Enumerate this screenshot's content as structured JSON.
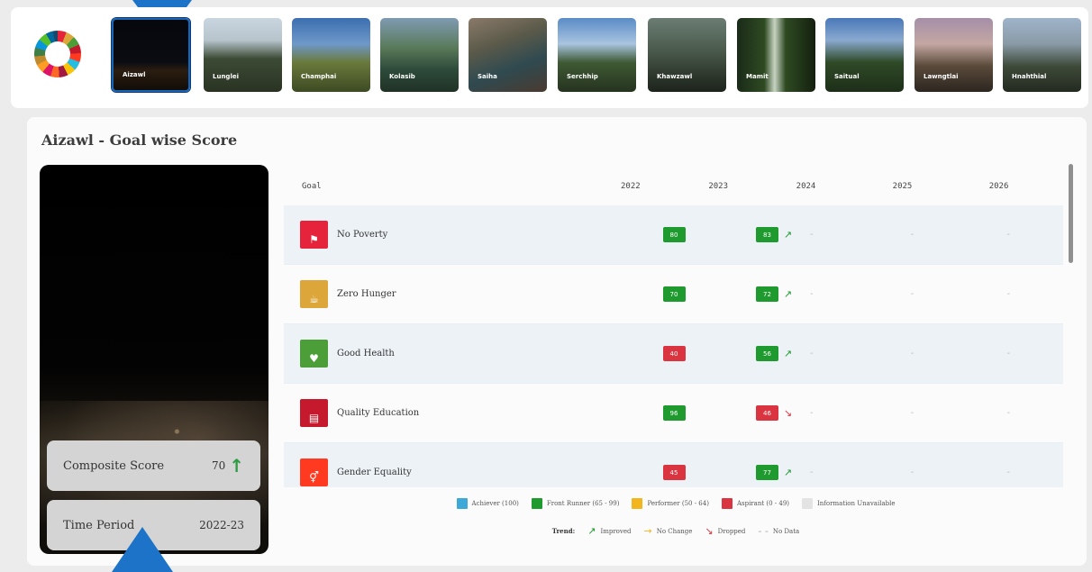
{
  "districts": [
    {
      "name": "Aizawl",
      "active": true
    },
    {
      "name": "Lunglei",
      "active": false
    },
    {
      "name": "Champhai",
      "active": false
    },
    {
      "name": "Kolasib",
      "active": false
    },
    {
      "name": "Saiha",
      "active": false
    },
    {
      "name": "Serchhip",
      "active": false
    },
    {
      "name": "Khawzawl",
      "active": false
    },
    {
      "name": "Mamit",
      "active": false
    },
    {
      "name": "Saitual",
      "active": false
    },
    {
      "name": "Lawngtlai",
      "active": false
    },
    {
      "name": "Hnahthial",
      "active": false
    }
  ],
  "section_title": "Aizawl - Goal wise Score",
  "city_panel": {
    "composite_label": "Composite Score",
    "composite_value": "70",
    "composite_trend": "up",
    "period_label": "Time Period",
    "period_value": "2022-23"
  },
  "table": {
    "headers": {
      "goal": "Goal",
      "y1": "2022",
      "y2": "2023",
      "y3": "2024",
      "y4": "2025",
      "y5": "2026"
    },
    "rows": [
      {
        "name": "No Poverty",
        "icon_color": "#e5243b",
        "icon": "⚑",
        "v1": "80",
        "c1": "green",
        "v2": "83",
        "c2": "green",
        "trend": "up"
      },
      {
        "name": "Zero Hunger",
        "icon_color": "#dda63a",
        "icon": "☕",
        "v1": "70",
        "c1": "green",
        "v2": "72",
        "c2": "green",
        "trend": "up"
      },
      {
        "name": "Good Health",
        "icon_color": "#4c9f38",
        "icon": "♥",
        "v1": "40",
        "c1": "red",
        "v2": "56",
        "c2": "green",
        "trend": "up"
      },
      {
        "name": "Quality Education",
        "icon_color": "#c5192d",
        "icon": "▤",
        "v1": "96",
        "c1": "green",
        "v2": "46",
        "c2": "red",
        "trend": "down"
      },
      {
        "name": "Gender Equality",
        "icon_color": "#ff3a21",
        "icon": "⚥",
        "v1": "45",
        "c1": "red",
        "v2": "77",
        "c2": "green",
        "trend": "up"
      }
    ],
    "dash": "-"
  },
  "legend": {
    "categories": [
      {
        "label": "Achiever (100)",
        "color": "#3ea8d8"
      },
      {
        "label": "Front Runner (65 - 99)",
        "color": "#1f9a2e"
      },
      {
        "label": "Performer (50 - 64)",
        "color": "#f2b51d"
      },
      {
        "label": "Aspirant (0 - 49)",
        "color": "#d9343f"
      },
      {
        "label": "Information Unavailable",
        "color": "#e3e3e3"
      }
    ],
    "trend_label": "Trend:",
    "trends": [
      {
        "icon": "↗",
        "label": "Improved",
        "color": "#1f9a2e"
      },
      {
        "icon": "→",
        "label": "No Change",
        "color": "#f2b51d"
      },
      {
        "icon": "↘",
        "label": "Dropped",
        "color": "#d9343f"
      },
      {
        "icon": "- -",
        "label": "No Data",
        "color": "#aaaaaa"
      }
    ]
  }
}
